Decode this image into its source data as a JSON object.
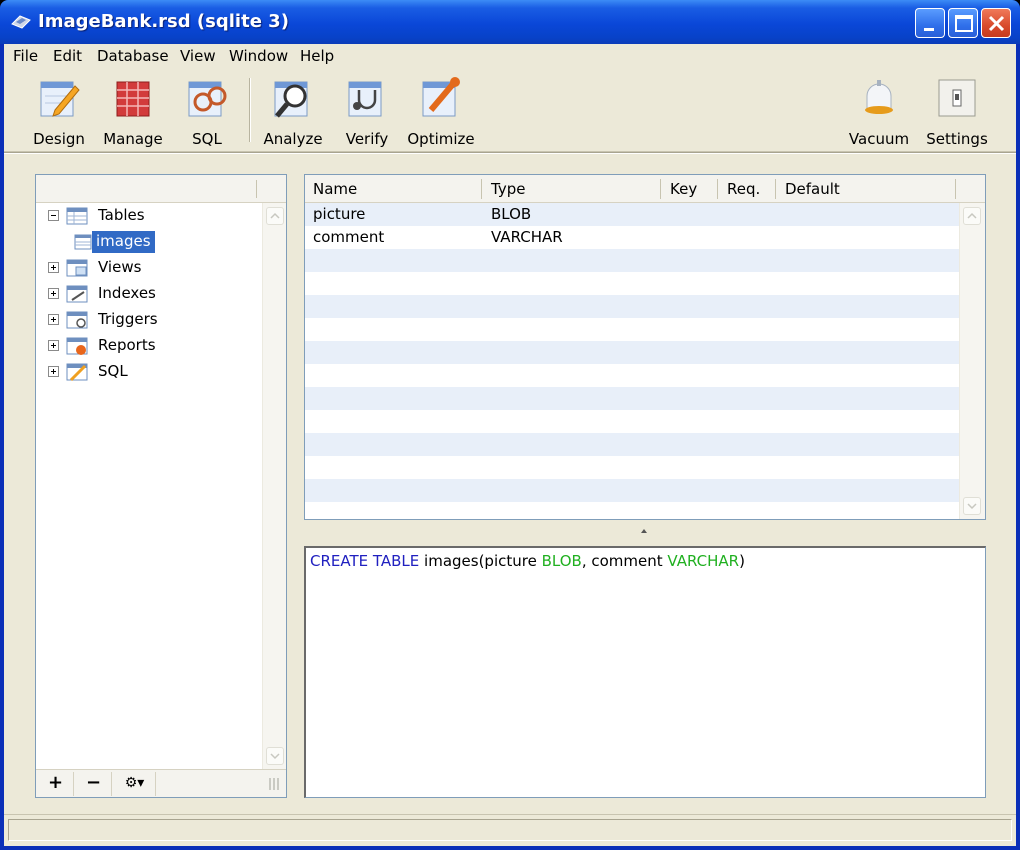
{
  "window": {
    "title": "ImageBank.rsd (sqlite 3)"
  },
  "menu": [
    "File",
    "Edit",
    "Database",
    "View",
    "Window",
    "Help"
  ],
  "toolbar": {
    "left": [
      {
        "label": "Design",
        "icon": "design-icon"
      },
      {
        "label": "Manage",
        "icon": "manage-icon"
      },
      {
        "label": "SQL",
        "icon": "sql-icon"
      }
    ],
    "middle": [
      {
        "label": "Analyze",
        "icon": "analyze-icon"
      },
      {
        "label": "Verify",
        "icon": "verify-icon"
      },
      {
        "label": "Optimize",
        "icon": "optimize-icon"
      }
    ],
    "right": [
      {
        "label": "Vacuum",
        "icon": "vacuum-icon"
      },
      {
        "label": "Settings",
        "icon": "settings-icon"
      }
    ]
  },
  "tree": {
    "nodes": [
      {
        "label": "Tables",
        "expanded": true,
        "icon": "tables-icon"
      },
      {
        "label": "images",
        "selected": true,
        "icon": "table-icon"
      },
      {
        "label": "Views",
        "expanded": false,
        "icon": "views-icon"
      },
      {
        "label": "Indexes",
        "expanded": false,
        "icon": "indexes-icon"
      },
      {
        "label": "Triggers",
        "expanded": false,
        "icon": "triggers-icon"
      },
      {
        "label": "Reports",
        "expanded": false,
        "icon": "reports-icon"
      },
      {
        "label": "SQL",
        "expanded": false,
        "icon": "sql-folder-icon"
      }
    ],
    "footer": {
      "add": "+",
      "remove": "−",
      "actions": "⚙▾"
    }
  },
  "fields_table": {
    "columns": [
      "Name",
      "Type",
      "Key",
      "Req.",
      "Default"
    ],
    "rows": [
      {
        "name": "picture",
        "type": "BLOB"
      },
      {
        "name": "comment",
        "type": "VARCHAR"
      }
    ]
  },
  "sql": {
    "kw": "CREATE TABLE",
    "part1": " images(picture ",
    "type1": "BLOB",
    "part2": ", comment ",
    "type2": "VARCHAR",
    "part3": ")"
  },
  "colors": {
    "keyword": "#2020c0",
    "type": "#20b020",
    "selection": "#316ac5",
    "titlebar": "#0a47d8"
  }
}
